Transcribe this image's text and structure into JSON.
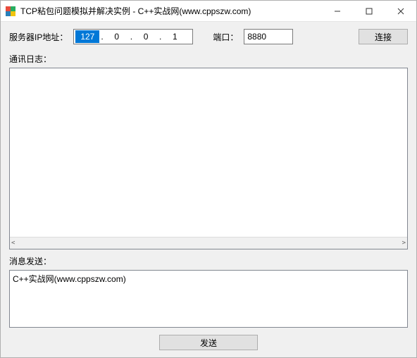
{
  "window": {
    "title": "TCP粘包问题模拟并解决实例 - C++实战网(www.cppszw.com)"
  },
  "form": {
    "ip_label": "服务器IP地址：",
    "ip": {
      "o1": "127",
      "o2": "0",
      "o3": "0",
      "o4": "1"
    },
    "port_label": "端口：",
    "port_value": "8880",
    "connect_label": "连接"
  },
  "log": {
    "label": "通讯日志："
  },
  "message": {
    "label": "消息发送：",
    "value": "C++实战网(www.cppszw.com)",
    "send_label": "发送"
  }
}
